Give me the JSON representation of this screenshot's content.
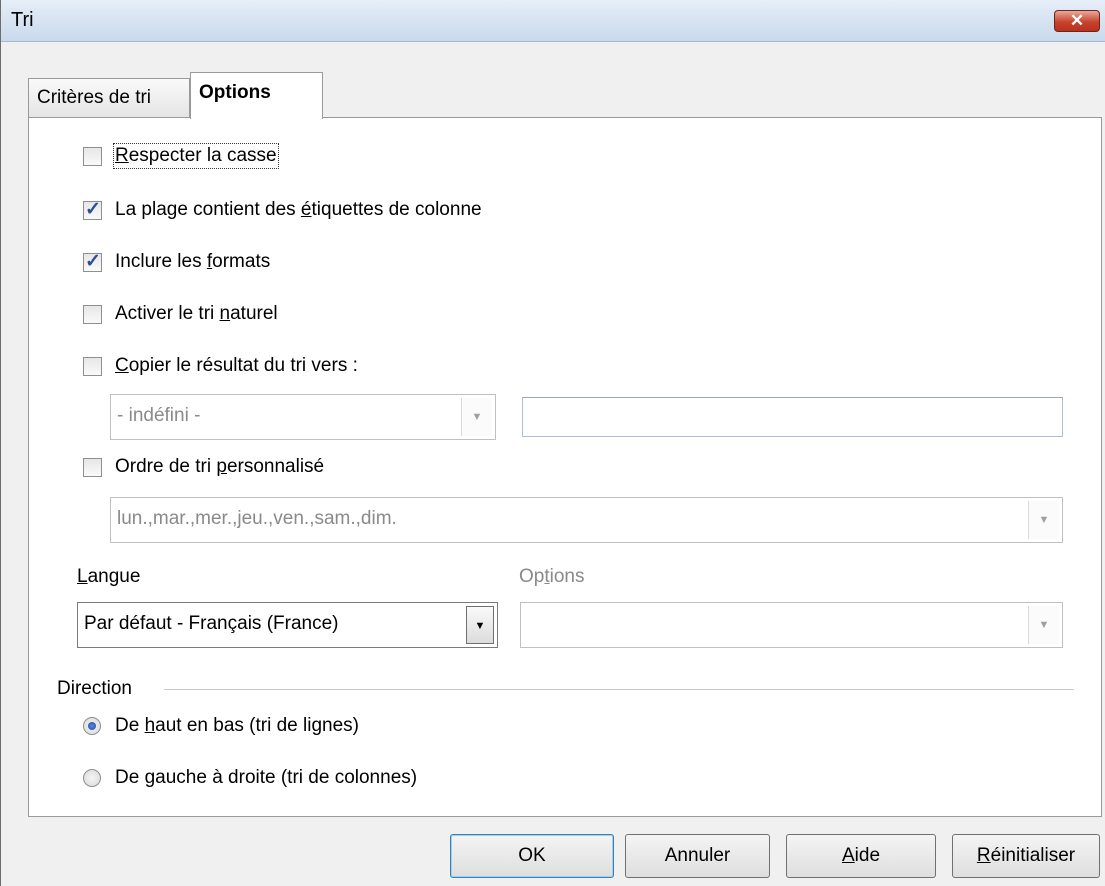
{
  "window": {
    "title": "Tri",
    "close_label": "✕"
  },
  "tabs": [
    {
      "label": "Critères de tri",
      "active": false
    },
    {
      "label": "Options",
      "active": true
    }
  ],
  "options": {
    "case_sensitive": {
      "label": "Respecter la casse",
      "checked": false
    },
    "has_headers": {
      "label_pre": "La plage contient des ",
      "label_u": "é",
      "label_post": "tiquettes de colonne",
      "checked": true
    },
    "include_formats": {
      "label_pre": "Inclure les ",
      "label_u": "f",
      "label_post": "ormats",
      "checked": true
    },
    "natural_sort": {
      "label_pre": "Activer le tri ",
      "label_u": "n",
      "label_post": "aturel",
      "checked": false
    },
    "copy_results": {
      "label_u": "C",
      "label_post": "opier le résultat du tri vers :",
      "checked": false,
      "range_combo_value": "- indéfini -",
      "range_input_value": ""
    },
    "custom_order": {
      "label_pre": "Ordre de tri ",
      "label_u": "p",
      "label_post": "ersonnalisé",
      "checked": false,
      "combo_value": "lun.,mar.,mer.,jeu.,ven.,sam.,dim."
    },
    "language": {
      "label_u": "L",
      "label_post": "angue",
      "value": "Par défaut - Français (France)"
    },
    "algo_options": {
      "label_pre": "Op",
      "label_u": "t",
      "label_post": "ions",
      "value": ""
    }
  },
  "direction": {
    "title": "Direction",
    "top_to_bottom": {
      "label_pre": "De ",
      "label_u": "h",
      "label_post": "aut en bas (tri de lignes)",
      "selected": true
    },
    "left_to_right": {
      "label_pre": "De ",
      "label_u": "g",
      "label_post": "auche à droite (tri de colonnes)",
      "selected": false
    }
  },
  "buttons": {
    "ok": "OK",
    "cancel": "Annuler",
    "help_u": "A",
    "help_post": "ide",
    "reset_u": "R",
    "reset_post": "éinitialiser"
  },
  "colors": {
    "accent": "#2b4e9c",
    "titlebar": "#c9d9ec",
    "close": "#c7432d"
  }
}
